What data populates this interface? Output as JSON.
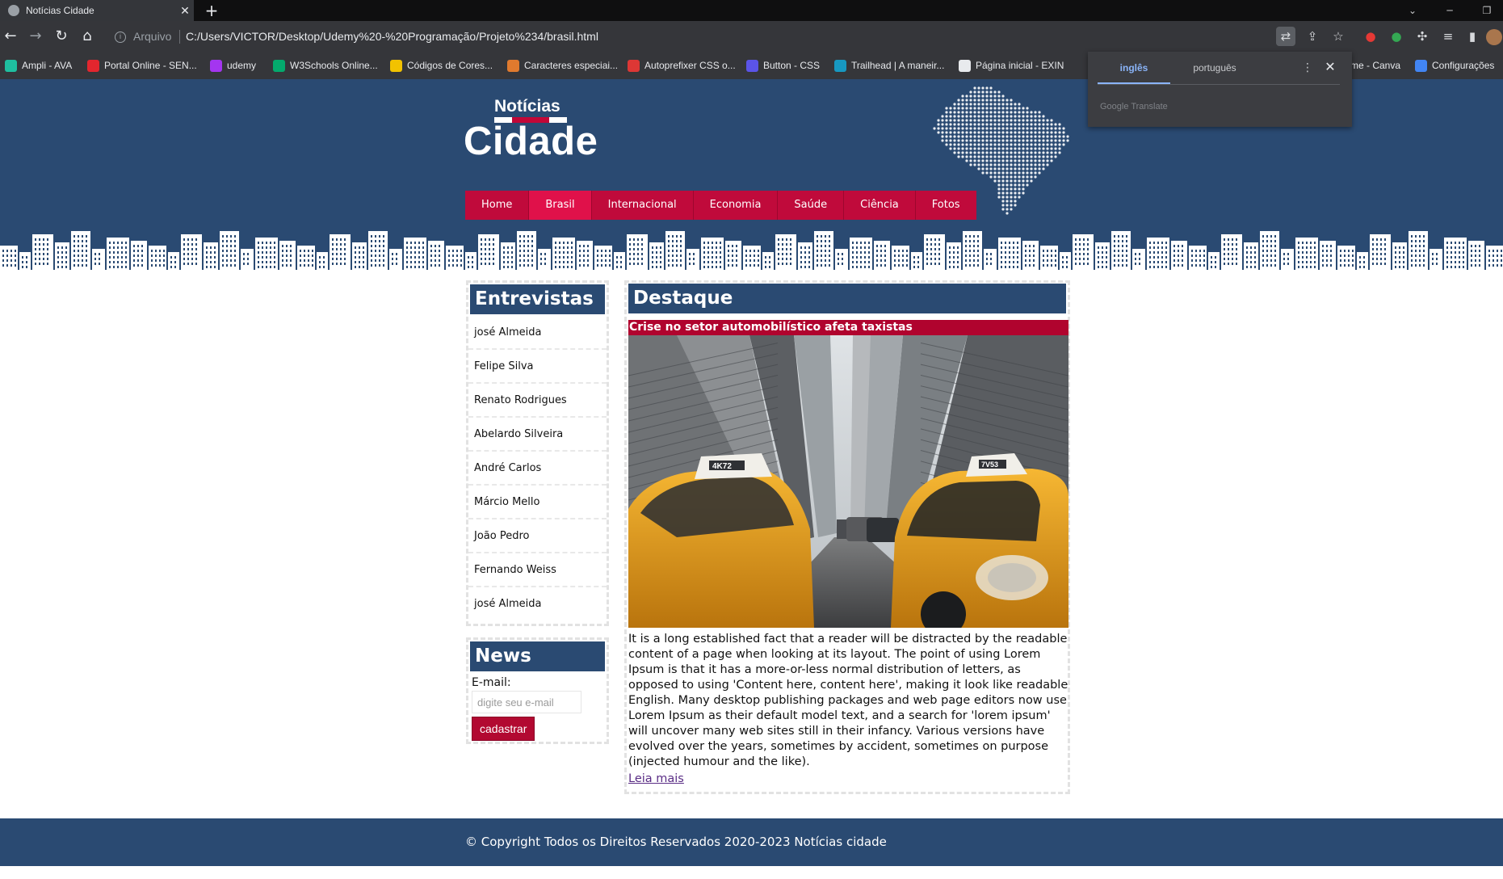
{
  "browser": {
    "tab_title": "Notícias Cidade",
    "tab_close": "✕",
    "new_tab": "+",
    "url_scheme_label": "Arquivo",
    "url": "C:/Users/VICTOR/Desktop/Udemy%20-%20Programação/Projeto%234/brasil.html",
    "bookmarks": [
      {
        "label": "Ampli - AVA",
        "color": "#1fbfa0"
      },
      {
        "label": "Portal Online - SEN...",
        "color": "#e3262e"
      },
      {
        "label": "udemy",
        "color": "#a435f0"
      },
      {
        "label": "W3Schools Online...",
        "color": "#04aa6d"
      },
      {
        "label": "Códigos de Cores...",
        "color": "#f2c200"
      },
      {
        "label": "Caracteres especiai...",
        "color": "#e07a2e"
      },
      {
        "label": "Autoprefixer CSS o...",
        "color": "#dd3735"
      },
      {
        "label": "Button - CSS",
        "color": "#5b54e8"
      },
      {
        "label": "Trailhead | A maneir...",
        "color": "#1798c1"
      },
      {
        "label": "Página inicial - EXIN",
        "color": "#e8eaed"
      },
      {
        "label": "me - Canva",
        "color": "#00c4cc"
      },
      {
        "label": "Configurações",
        "color": "#4285f4"
      }
    ],
    "translate_popup": {
      "tab_source": "inglês",
      "tab_target": "português",
      "brand": "Google Translate",
      "menu_glyph": "⋮",
      "close_glyph": "✕"
    }
  },
  "site": {
    "logo_top": "Notícias",
    "logo_main": "Cidade",
    "nav": [
      "Home",
      "Brasil",
      "Internacional",
      "Economia",
      "Saúde",
      "Ciência",
      "Fotos"
    ],
    "nav_active_index": 1,
    "interviews": {
      "title": "Entrevistas",
      "items": [
        "josé Almeida",
        "Felipe Silva",
        "Renato Rodrigues",
        "Abelardo Silveira",
        "André Carlos",
        "Márcio Mello",
        "João Pedro",
        "Fernando Weiss",
        "josé Almeida"
      ]
    },
    "news": {
      "title": "News",
      "email_label": "E-mail:",
      "email_placeholder": "digite seu e-mail",
      "button_label": "cadastrar"
    },
    "highlight": {
      "title": "Destaque",
      "headline": "Crise no setor automobilístico afeta taxistas",
      "photo_icon": "city-taxis-photo",
      "taxi_plates": [
        "4K72",
        "7V53"
      ],
      "body": "It is a long established fact that a reader will be distracted by the readable content of a page when looking at its layout. The point of using Lorem Ipsum is that it has a more-or-less normal distribution of letters, as opposed to using 'Content here, content here', making it look like readable English. Many desktop publishing packages and web page editors now use Lorem Ipsum as their default model text, and a search for 'lorem ipsum' will uncover many web sites still in their infancy. Various versions have evolved over the years, sometimes by accident, sometimes on purpose (injected humour and the like).",
      "read_more": "Leia mais"
    },
    "footer": "© Copyright Todos os Direitos Reservados 2020-2023 Notícias cidade"
  },
  "colors": {
    "brand_blue": "#2a4a72",
    "brand_red": "#c00a3b",
    "nav_active": "#e0114a"
  }
}
